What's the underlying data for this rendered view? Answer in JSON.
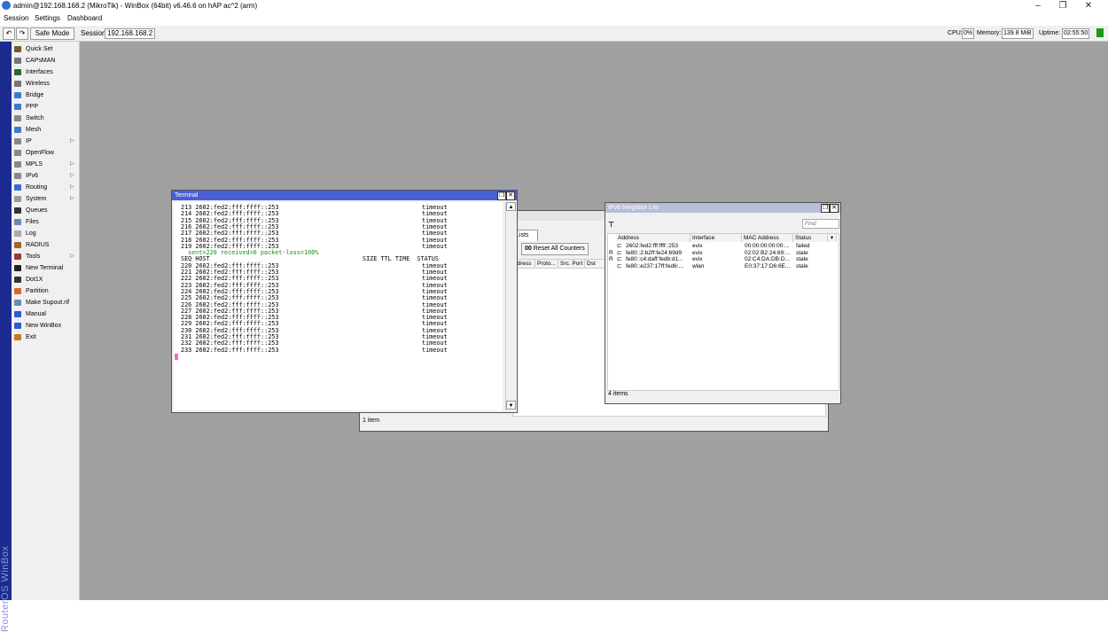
{
  "window": {
    "title": "admin@192.168.168.2 (MikroTik) - WinBox (64bit) v6.46.6 on hAP ac^2 (arm)",
    "minimize": "–",
    "maximize": "❐",
    "close": "✕"
  },
  "menu": [
    "Session",
    "Settings",
    "Dashboard"
  ],
  "toolbar": {
    "undo": "↶",
    "redo": "↷",
    "safe_mode": "Safe Mode",
    "session_label": "Session:",
    "session_value": "192.168.168.2",
    "cpu_label": "CPU:",
    "cpu_value": "0%",
    "memory_label": "Memory:",
    "memory_value": "139.8 MiB",
    "uptime_label": "Uptime:",
    "uptime_value": "02:55:50",
    "status_color": "#1a9a1a"
  },
  "brand": "RouterOS WinBox",
  "sidebar": {
    "items": [
      {
        "label": "Quick Set",
        "icon": "quick-set-icon",
        "color": "#7a5a2a",
        "submenu": false
      },
      {
        "label": "CAPsMAN",
        "icon": "capsman-icon",
        "color": "#777777",
        "submenu": false
      },
      {
        "label": "Interfaces",
        "icon": "interfaces-icon",
        "color": "#2a6a2a",
        "submenu": false
      },
      {
        "label": "Wireless",
        "icon": "wireless-icon",
        "color": "#777777",
        "submenu": false
      },
      {
        "label": "Bridge",
        "icon": "bridge-icon",
        "color": "#3a7ad4",
        "submenu": false
      },
      {
        "label": "PPP",
        "icon": "ppp-icon",
        "color": "#3a7ad4",
        "submenu": false
      },
      {
        "label": "Switch",
        "icon": "switch-icon",
        "color": "#888888",
        "submenu": false
      },
      {
        "label": "Mesh",
        "icon": "mesh-icon",
        "color": "#3a7ad4",
        "submenu": false
      },
      {
        "label": "IP",
        "icon": "ip-icon",
        "color": "#888888",
        "submenu": true
      },
      {
        "label": "OpenFlow",
        "icon": "openflow-icon",
        "color": "#888888",
        "submenu": false
      },
      {
        "label": "MPLS",
        "icon": "mpls-icon",
        "color": "#888888",
        "submenu": true
      },
      {
        "label": "IPv6",
        "icon": "ipv6-icon",
        "color": "#888888",
        "submenu": true
      },
      {
        "label": "Routing",
        "icon": "routing-icon",
        "color": "#3a6ad4",
        "submenu": true
      },
      {
        "label": "System",
        "icon": "system-icon",
        "color": "#999999",
        "submenu": true
      },
      {
        "label": "Queues",
        "icon": "queues-icon",
        "color": "#333333",
        "submenu": false
      },
      {
        "label": "Files",
        "icon": "files-icon",
        "color": "#6a8ab4",
        "submenu": false
      },
      {
        "label": "Log",
        "icon": "log-icon",
        "color": "#aaaaaa",
        "submenu": false
      },
      {
        "label": "RADIUS",
        "icon": "radius-icon",
        "color": "#9a6a2a",
        "submenu": false
      },
      {
        "label": "Tools",
        "icon": "tools-icon",
        "color": "#9a3a3a",
        "submenu": true
      },
      {
        "label": "New Terminal",
        "icon": "terminal-icon",
        "color": "#222222",
        "submenu": false
      },
      {
        "label": "Dot1X",
        "icon": "dot1x-icon",
        "color": "#333333",
        "submenu": false
      },
      {
        "label": "Partition",
        "icon": "partition-icon",
        "color": "#d46a2a",
        "submenu": false
      },
      {
        "label": "Make Supout.rif",
        "icon": "supout-icon",
        "color": "#6a8ab4",
        "submenu": false
      },
      {
        "label": "Manual",
        "icon": "manual-icon",
        "color": "#2a5ad4",
        "submenu": false
      },
      {
        "label": "New WinBox",
        "icon": "winbox-icon",
        "color": "#2a5ad4",
        "submenu": false
      },
      {
        "label": "Exit",
        "icon": "exit-icon",
        "color": "#c47a2a",
        "submenu": false
      }
    ]
  },
  "terminal": {
    "title": "Terminal",
    "lines_top": [
      {
        "text": "213 2602:fed2:fff:ffff::253",
        "status": "timeout"
      },
      {
        "text": "214 2602:fed2:fff:ffff::253",
        "status": "timeout"
      },
      {
        "text": "215 2602:fed2:fff:ffff::253",
        "status": "timeout"
      },
      {
        "text": "216 2602:fed2:fff:ffff::253",
        "status": "timeout"
      },
      {
        "text": "217 2602:fed2:fff:ffff::253",
        "status": "timeout"
      },
      {
        "text": "218 2602:fed2:fff:ffff::253",
        "status": "timeout"
      },
      {
        "text": "219 2602:fed2:fff:ffff::253",
        "status": "timeout"
      }
    ],
    "summary": "sent=220 received=0 packet-loss=100%",
    "header_left": "SEQ HOST",
    "header_right": "SIZE TTL TIME  STATUS",
    "lines_bottom": [
      {
        "text": "220 2602:fed2:fff:ffff::253",
        "status": "timeout"
      },
      {
        "text": "221 2602:fed2:fff:ffff::253",
        "status": "timeout"
      },
      {
        "text": "222 2602:fed2:fff:ffff::253",
        "status": "timeout"
      },
      {
        "text": "223 2602:fed2:fff:ffff::253",
        "status": "timeout"
      },
      {
        "text": "224 2602:fed2:fff:ffff::253",
        "status": "timeout"
      },
      {
        "text": "225 2602:fed2:fff:ffff::253",
        "status": "timeout"
      },
      {
        "text": "226 2602:fed2:fff:ffff::253",
        "status": "timeout"
      },
      {
        "text": "227 2602:fed2:fff:ffff::253",
        "status": "timeout"
      },
      {
        "text": "228 2602:fed2:fff:ffff::253",
        "status": "timeout"
      },
      {
        "text": "229 2602:fed2:fff:ffff::253",
        "status": "timeout"
      },
      {
        "text": "230 2602:fed2:fff:ffff::253",
        "status": "timeout"
      },
      {
        "text": "231 2602:fed2:fff:ffff::253",
        "status": "timeout"
      },
      {
        "text": "232 2602:fed2:fff:ffff::253",
        "status": "timeout"
      },
      {
        "text": "233 2602:fed2:fff:ffff::253",
        "status": "timeout"
      }
    ]
  },
  "midwin": {
    "tab": "Lists",
    "reset_counters_icon": "00",
    "reset_counters_label": "Reset All Counters",
    "columns": [
      "ddress",
      "Proto...",
      "Src. Port",
      "Dst"
    ],
    "status": "1 item"
  },
  "ipv6": {
    "title": "IPv6 Neighbor List",
    "find_placeholder": "Find",
    "columns": [
      "Address",
      "Interface",
      "MAC Address",
      "Status"
    ],
    "rows": [
      {
        "flag": "",
        "address": "2602:fed2:fff:ffff::253",
        "interface": "evix",
        "mac": "00:00:00:00:00:...",
        "status": "failed"
      },
      {
        "flag": "R",
        "address": "fe80::2:b2ff:fe24:69d9",
        "interface": "evix",
        "mac": "02:02:B2:24:69:...",
        "status": "stale"
      },
      {
        "flag": "R",
        "address": "fe80::c4:daff:fedb:d1...",
        "interface": "evix",
        "mac": "02:C4:DA:DB:D...",
        "status": "stale"
      },
      {
        "flag": "",
        "address": "fe80::e237:17ff:fed6:...",
        "interface": "wlan",
        "mac": "E0:37:17:D6:6E...",
        "status": "stale"
      }
    ],
    "count": "4 items"
  }
}
